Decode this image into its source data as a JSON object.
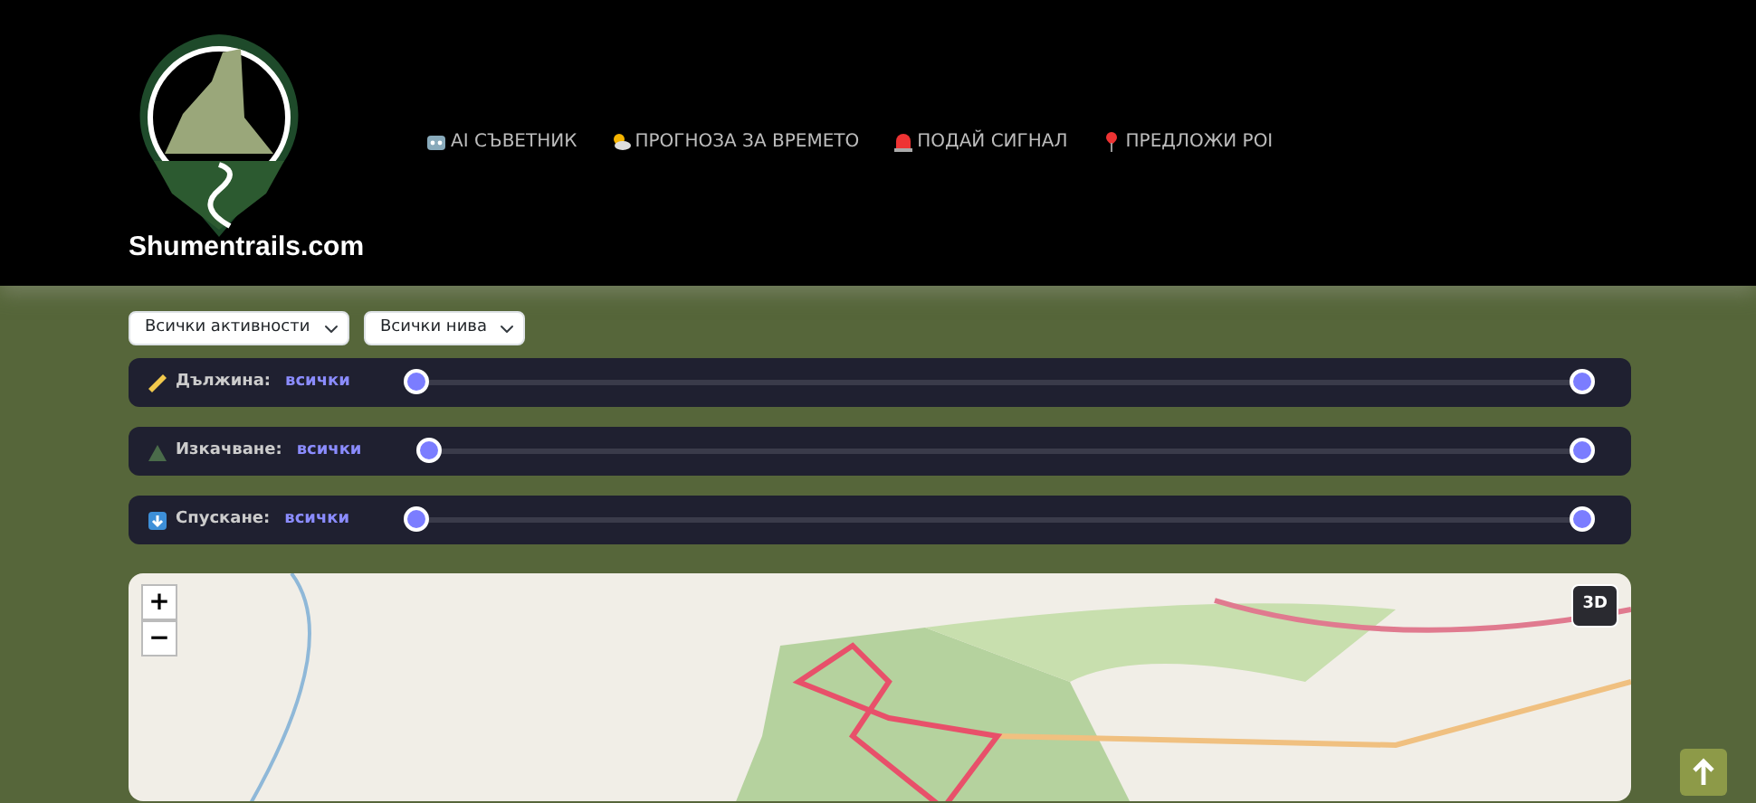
{
  "logo": {
    "text": "Shumentrails.com"
  },
  "nav": [
    {
      "kind": "robot",
      "label": "AI СЪВЕТНИК"
    },
    {
      "kind": "weather",
      "label": "ПРОГНОЗА ЗА ВРЕМЕТО"
    },
    {
      "kind": "siren",
      "label": "ПОДАЙ СИГНАЛ"
    },
    {
      "kind": "pin",
      "label": "ПРЕДЛОЖИ POI"
    }
  ],
  "filters": [
    {
      "value": "Всички активности"
    },
    {
      "value": "Всички нива"
    }
  ],
  "sliders": [
    {
      "kind": "ruler",
      "label": "Дължина:",
      "reading": "всички",
      "thumbs": [
        {
          "level": 0
        },
        {
          "level": 1
        }
      ]
    },
    {
      "kind": "mountain",
      "label": "Изкачване:",
      "reading": "всички",
      "thumbs": [
        {
          "level": 0
        },
        {
          "level": 1
        }
      ]
    },
    {
      "kind": "down",
      "label": "Спускане:",
      "reading": "всички",
      "thumbs": [
        {
          "level": 0
        },
        {
          "level": 1
        }
      ]
    }
  ],
  "map": {
    "zoom_in": "+",
    "zoom_out": "−",
    "mode_button": "3D"
  }
}
